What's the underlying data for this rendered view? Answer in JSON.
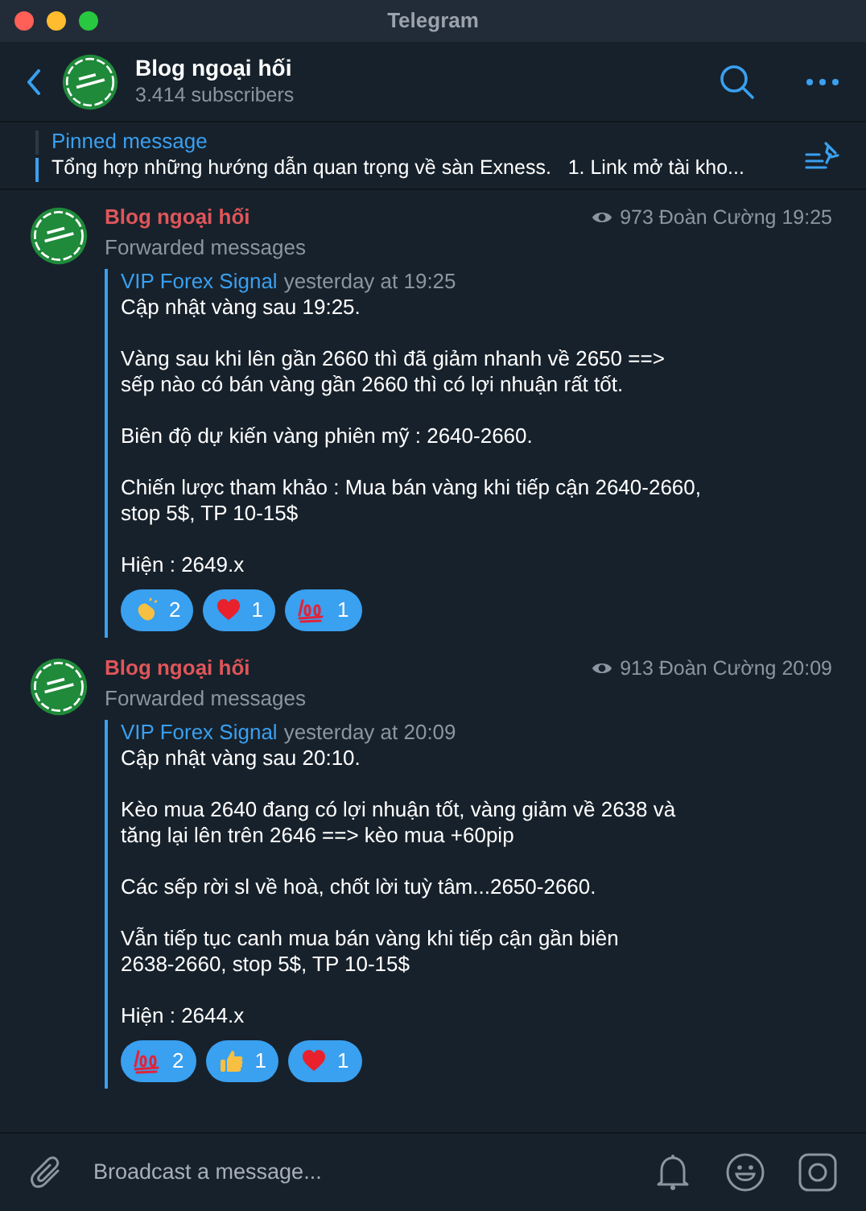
{
  "window": {
    "title": "Telegram"
  },
  "header": {
    "channel_name": "Blog ngoại hối",
    "subscribers": "3.414 subscribers"
  },
  "pinned": {
    "label": "Pinned message",
    "text": "Tổng hợp những hướng dẫn quan trọng về sàn Exness.   1. Link mở tài kho..."
  },
  "messages": [
    {
      "sender": "Blog ngoại hối",
      "subtitle": "Forwarded messages",
      "views": "973",
      "author": "Đoàn Cường",
      "time": "19:25",
      "forward_from": "VIP Forex Signal",
      "forward_time": "yesterday at 19:25",
      "text": "Cập nhật vàng sau 19:25.\n\nVàng sau khi lên gần 2660 thì đã giảm nhanh về 2650 ==>\nsếp nào có bán vàng gần 2660 thì có lợi nhuận rất tốt.\n\nBiên độ dự kiến vàng phiên mỹ : 2640-2660.\n\nChiến lược tham khảo : Mua bán vàng khi tiếp cận 2640-2660,\nstop 5$, TP 10-15$\n\nHiện : 2649.x",
      "reactions": [
        {
          "kind": "clap",
          "count": "2"
        },
        {
          "kind": "heart",
          "count": "1"
        },
        {
          "kind": "hundred",
          "count": "1"
        }
      ]
    },
    {
      "sender": "Blog ngoại hối",
      "subtitle": "Forwarded messages",
      "views": "913",
      "author": "Đoàn Cường",
      "time": "20:09",
      "forward_from": "VIP Forex Signal",
      "forward_time": "yesterday at 20:09",
      "text": "Cập nhật vàng sau 20:10.\n\nKèo mua 2640 đang có lợi nhuận tốt, vàng giảm về 2638 và\ntăng lại lên trên 2646 ==> kèo mua +60pip\n\nCác sếp rời sl về hoà, chốt lời tuỳ tâm...2650-2660.\n\nVẫn tiếp tục canh mua bán vàng khi tiếp cận gần biên\n2638-2660, stop 5$, TP 10-15$\n\nHiện : 2644.x",
      "reactions": [
        {
          "kind": "hundred",
          "count": "2"
        },
        {
          "kind": "thumbs_up",
          "count": "1"
        },
        {
          "kind": "heart",
          "count": "1"
        }
      ]
    }
  ],
  "composer": {
    "placeholder": "Broadcast a message..."
  }
}
